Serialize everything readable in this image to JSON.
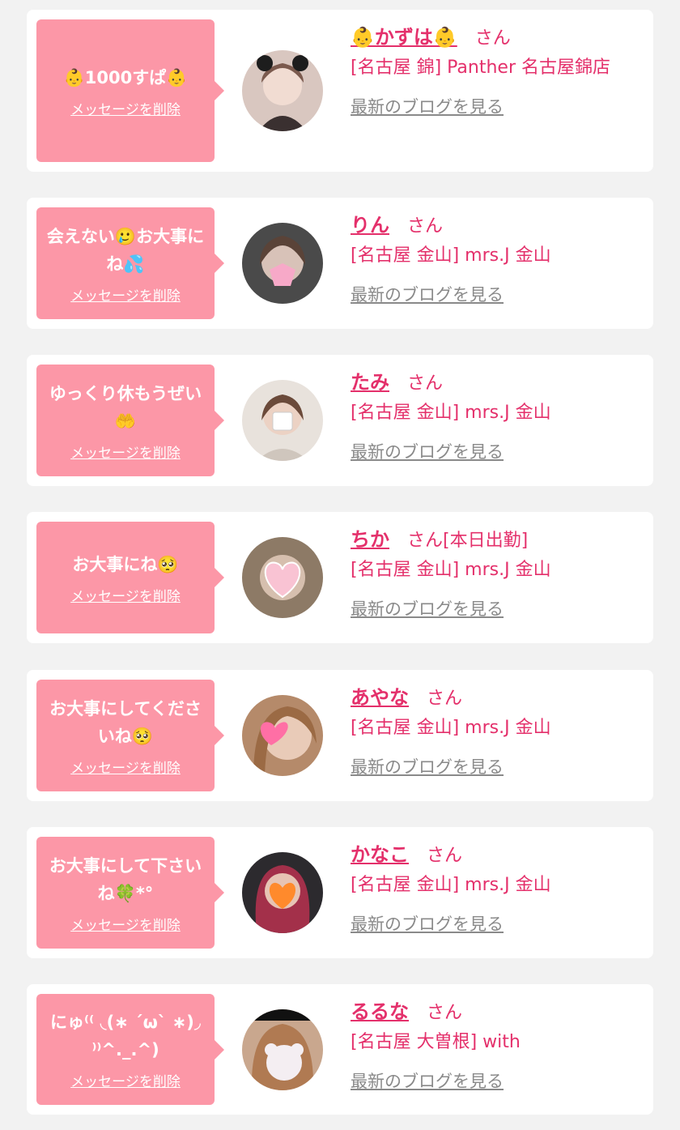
{
  "cards": [
    {
      "message": "👶1000すぱ👶",
      "delete_label": "メッセージを削除",
      "name": "👶かずは👶",
      "suffix": "さん",
      "shop": "[名古屋 錦] Panther 名古屋錦店",
      "blog_label": "最新のブログを見る",
      "avatar_icon": "person-photo-icon"
    },
    {
      "message": "会えない🥲お大事にね💦",
      "delete_label": "メッセージを削除",
      "name": "りん",
      "suffix": "さん",
      "shop": "[名古屋 金山] mrs.J 金山",
      "blog_label": "最新のブログを見る",
      "avatar_icon": "person-photo-icon"
    },
    {
      "message": "ゆっくり休もうぜい🤲",
      "delete_label": "メッセージを削除",
      "name": "たみ",
      "suffix": "さん",
      "shop": "[名古屋 金山] mrs.J 金山",
      "blog_label": "最新のブログを見る",
      "avatar_icon": "person-photo-icon"
    },
    {
      "message": "お大事にね🥺",
      "delete_label": "メッセージを削除",
      "name": "ちか",
      "suffix": "さん[本日出勤]",
      "shop": "[名古屋 金山] mrs.J 金山",
      "blog_label": "最新のブログを見る",
      "avatar_icon": "person-photo-icon"
    },
    {
      "message": "お大事にしてくださいね🥺",
      "delete_label": "メッセージを削除",
      "name": "あやな",
      "suffix": "さん",
      "shop": "[名古屋 金山] mrs.J 金山",
      "blog_label": "最新のブログを見る",
      "avatar_icon": "person-photo-icon"
    },
    {
      "message": "お大事にして下さいね🍀*°",
      "delete_label": "メッセージを削除",
      "name": "かなこ",
      "suffix": "さん",
      "shop": "[名古屋 金山] mrs.J 金山",
      "blog_label": "最新のブログを見る",
      "avatar_icon": "person-photo-icon"
    },
    {
      "message": "にゅ⁽⁽ ◟(∗ ˊωˋ ∗)◞ ⁾⁾^._.^)",
      "delete_label": "メッセージを削除",
      "name": "るるな",
      "suffix": "さん",
      "shop": "[名古屋 大曽根] with",
      "blog_label": "最新のブログを見る",
      "avatar_icon": "person-photo-icon"
    }
  ],
  "colors": {
    "bubble": "#fc97a7",
    "accent": "#e4306b",
    "link_gray": "#8a8a8a",
    "background": "#f2f2f2"
  }
}
